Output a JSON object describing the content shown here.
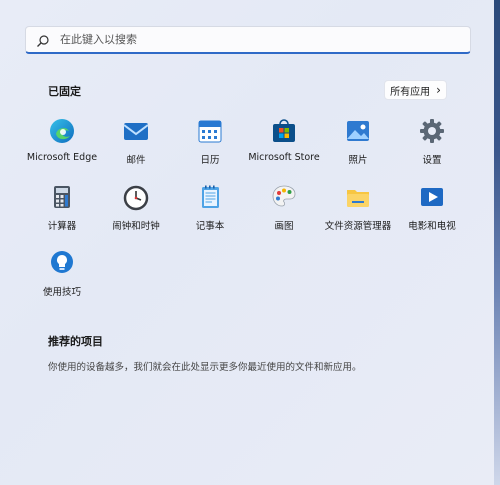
{
  "search": {
    "placeholder": "在此键入以搜索",
    "icon": "search-icon"
  },
  "pinned": {
    "title": "已固定",
    "all_apps_label": "所有应用",
    "all_apps_chevron": "›",
    "apps": [
      {
        "label": "Microsoft Edge",
        "icon": "edge-icon"
      },
      {
        "label": "邮件",
        "icon": "mail-icon"
      },
      {
        "label": "日历",
        "icon": "calendar-icon"
      },
      {
        "label": "Microsoft Store",
        "icon": "store-icon"
      },
      {
        "label": "照片",
        "icon": "photos-icon"
      },
      {
        "label": "设置",
        "icon": "settings-icon"
      },
      {
        "label": "计算器",
        "icon": "calculator-icon"
      },
      {
        "label": "闹钟和时钟",
        "icon": "clock-icon"
      },
      {
        "label": "记事本",
        "icon": "notepad-icon"
      },
      {
        "label": "画图",
        "icon": "paint-icon"
      },
      {
        "label": "文件资源管理器",
        "icon": "file-explorer-icon"
      },
      {
        "label": "电影和电视",
        "icon": "movies-tv-icon"
      },
      {
        "label": "使用技巧",
        "icon": "tips-icon"
      }
    ]
  },
  "recommended": {
    "title": "推荐的项目",
    "text": "你使用的设备越多，我们就会在此处显示更多你最近使用的文件和新应用。"
  },
  "colors": {
    "accent": "#2f6ac7",
    "edge": "#1aa0d8",
    "mail": "#1f6fc5",
    "store": "#0b4f8a"
  }
}
